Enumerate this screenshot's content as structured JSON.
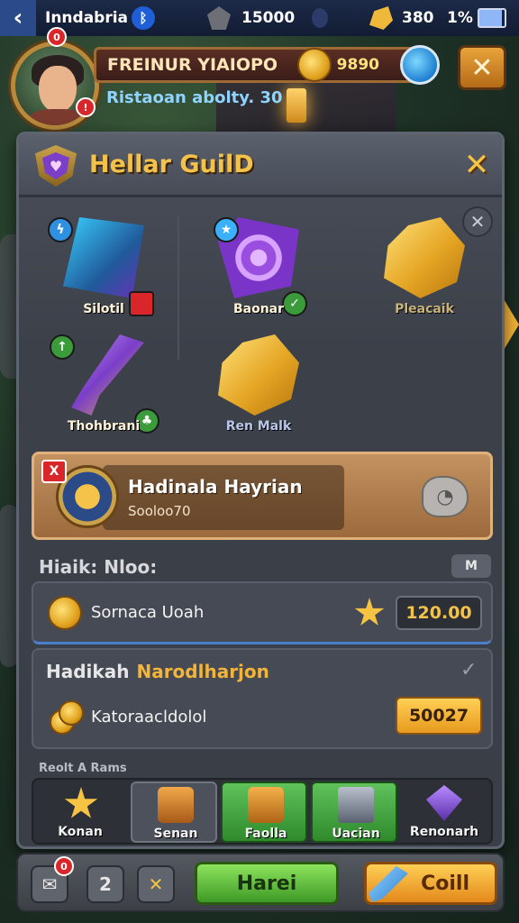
{
  "status_bar": {
    "title": "Inndabria",
    "gems": "15000",
    "gold": "380",
    "battery": "1%"
  },
  "player": {
    "name": "FREINUR YIAIOPO",
    "coins": "9890",
    "rank_text": "Ristaoan abolty. 30",
    "notification_count": "0"
  },
  "panel": {
    "title": "Hellar GuilD",
    "items": [
      {
        "label": "Silotil"
      },
      {
        "label": "Baonar"
      },
      {
        "label": "Pleacaik"
      },
      {
        "label": "Thohbrani"
      },
      {
        "label": "Ren Malk"
      }
    ],
    "selected": {
      "badge": "X",
      "title": "Hadinala Hayrian",
      "subtitle": "Sooloo70"
    },
    "section_label": "Hiaik: Nloo:",
    "section_tag": "M",
    "reward_row": {
      "text": "Sornaca Uoah",
      "value": "120.00"
    },
    "expand_row": {
      "label_a": "Hadikah",
      "label_b": "Narodlharjon",
      "text": "Katoraacldolol",
      "value": "50027"
    },
    "tabs_label": "Reolt A Rams",
    "tabs": [
      {
        "label": "Konan"
      },
      {
        "label": "Senan"
      },
      {
        "label": "Faolla"
      },
      {
        "label": "Uacian"
      },
      {
        "label": "Renonarh"
      }
    ]
  },
  "bottom": {
    "count": "2",
    "badge": "0",
    "primary_label": "Harei",
    "secondary_label": "Coill"
  },
  "colors": {
    "accent_gold": "#f3c24a",
    "accent_green": "#5fc25a",
    "accent_orange": "#e3891a",
    "panel_bg": "#3c4049"
  }
}
